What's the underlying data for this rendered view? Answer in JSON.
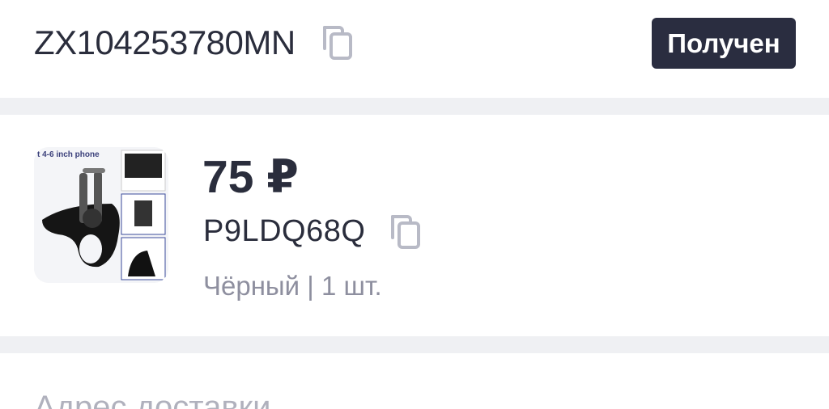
{
  "order": {
    "tracking_number": "ZX104253780MN",
    "status": "Получен"
  },
  "product": {
    "image_caption": "t 4-6 inch phone",
    "price": "75 ₽",
    "sku": "P9LDQ68Q",
    "variant": "Чёрный | 1 шт."
  },
  "delivery": {
    "section_title": "Адрес доставки"
  },
  "colors": {
    "text_primary": "#2a2d3c",
    "text_secondary": "#8e8f9f",
    "badge_background": "#2a2d40",
    "separator": "#eff0f3",
    "icon": "#b8bac6"
  },
  "icons": {
    "tracking_copy": "copy-icon",
    "sku_copy": "copy-icon"
  }
}
